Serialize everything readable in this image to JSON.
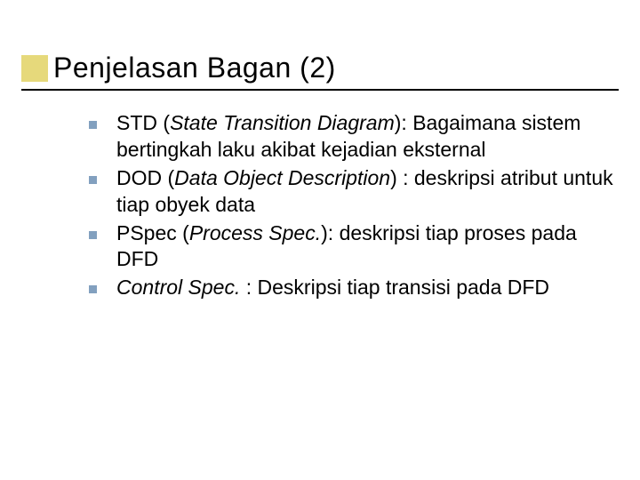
{
  "title": "Penjelasan Bagan (2)",
  "items": [
    {
      "pre": "STD (",
      "ital": "State Transition Diagram",
      "post": "): Bagaimana sistem bertingkah laku akibat kejadian eksternal"
    },
    {
      "pre": "DOD (",
      "ital": "Data Object Description",
      "post": ") : deskripsi atribut untuk tiap obyek data"
    },
    {
      "pre": "PSpec (",
      "ital": "Process Spec.",
      "post": "): deskripsi tiap proses pada DFD"
    },
    {
      "pre": "",
      "ital": "Control Spec.",
      "post": " : Deskripsi tiap transisi pada DFD"
    }
  ]
}
